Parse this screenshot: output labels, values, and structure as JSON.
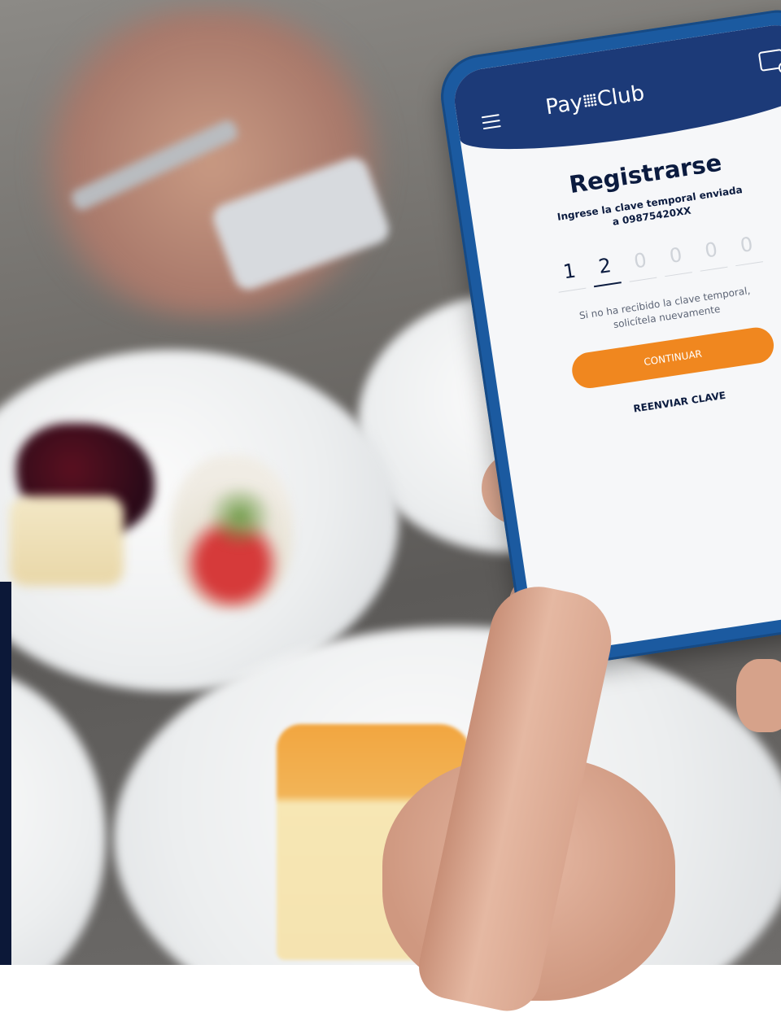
{
  "app": {
    "logo_left": "Pay",
    "logo_right": "Club",
    "icons": {
      "menu": "hamburger-menu-icon",
      "wallet": "card-wallet-icon"
    }
  },
  "register": {
    "title": "Registrarse",
    "subtitle": "Ingrese la clave temporal enviada a 09875420XX",
    "code_digits": [
      "1",
      "2",
      "0",
      "0",
      "0",
      "0"
    ],
    "help_text": "Si no ha recibido la clave temporal, solicítela nuevamente",
    "continue_label": "CONTINUAR",
    "resend_label": "REENVIAR CLAVE"
  },
  "colors": {
    "header": "#1c3a78",
    "phone_frame": "#1b5aa0",
    "primary_button": "#f0871f",
    "text_dark": "#0b1b3f"
  }
}
